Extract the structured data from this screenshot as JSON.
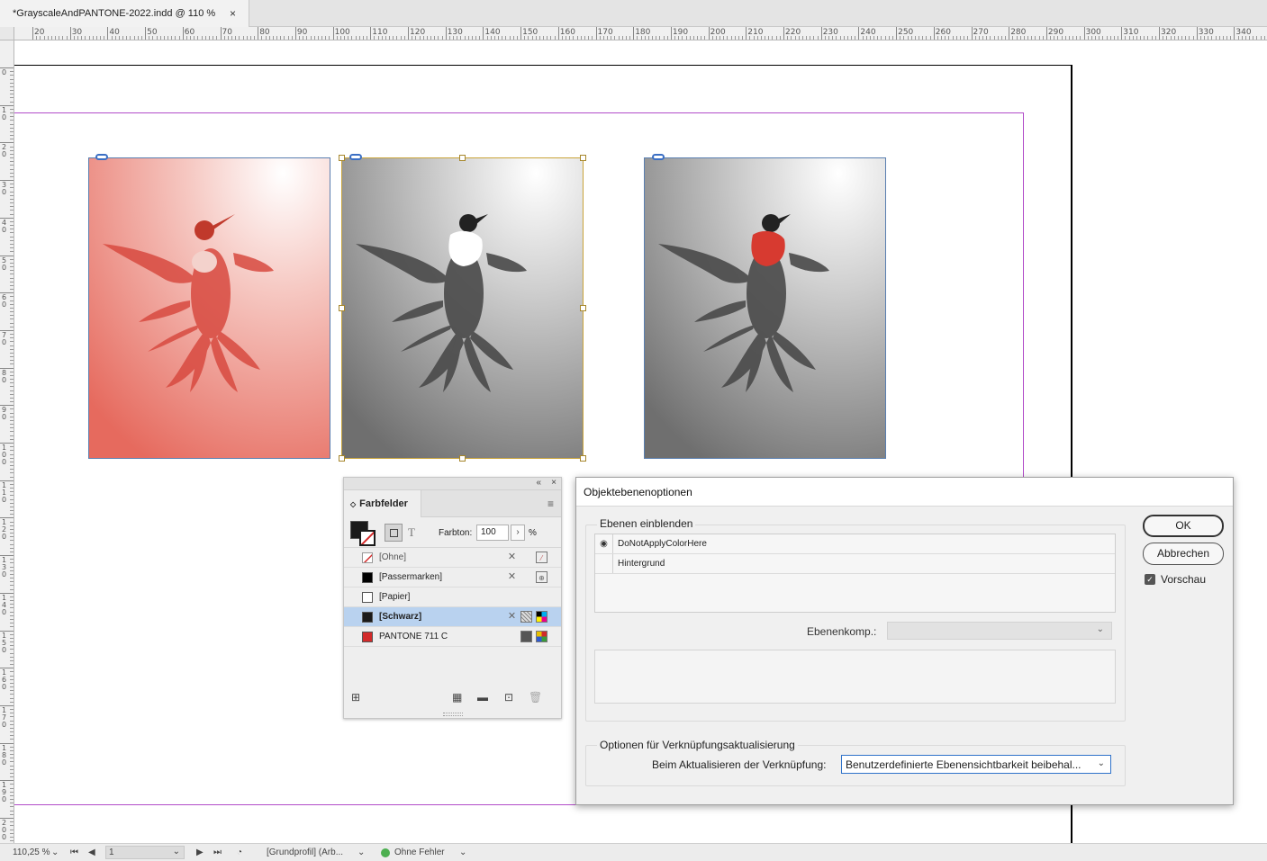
{
  "document_tab": {
    "title": "*GrayscaleAndPANTONE-2022.indd @ 110 %",
    "close_glyph": "×"
  },
  "ruler": {
    "top_labels": [
      "20",
      "30",
      "40",
      "50",
      "60",
      "70",
      "80",
      "90",
      "100",
      "110",
      "120",
      "130",
      "140",
      "150",
      "160",
      "170",
      "180",
      "190",
      "200",
      "210",
      "220",
      "230",
      "240",
      "250",
      "260",
      "270",
      "280",
      "290",
      "300",
      "310",
      "320",
      "330",
      "340"
    ],
    "left_labels": [
      "0",
      "10",
      "20",
      "30",
      "40",
      "50",
      "60",
      "70",
      "80",
      "90",
      "100",
      "110",
      "120",
      "130",
      "140",
      "150",
      "160",
      "170",
      "180",
      "190",
      "200"
    ]
  },
  "images": [
    {
      "name": "hummingbird-red-tint",
      "tint": "pantone-red"
    },
    {
      "name": "hummingbird-grayscale-selected",
      "tint": "grayscale-white-throat"
    },
    {
      "name": "hummingbird-grayscale-red-throat",
      "tint": "grayscale-red-throat"
    }
  ],
  "swatches_panel": {
    "title": "Farbfelder",
    "tint_label": "Farbton:",
    "tint_value": "100",
    "tint_unit": "%",
    "text_glyph": "T",
    "collapse_glyph": "«",
    "close_glyph": "×",
    "menu_glyph": "≡",
    "items": [
      {
        "name": "[Ohne]",
        "color": "none"
      },
      {
        "name": "[Passermarken]",
        "color": "#000000"
      },
      {
        "name": "[Papier]",
        "color": "#ffffff"
      },
      {
        "name": "[Schwarz]",
        "color": "#1a1a1a",
        "selected": true
      },
      {
        "name": "PANTONE 711 C",
        "color": "#d22a2a"
      }
    ]
  },
  "dialog": {
    "title": "Objektebenenoptionen",
    "show_layers_label": "Ebenen einblenden",
    "layers": [
      {
        "name": "DoNotApplyColorHere",
        "visible": true
      },
      {
        "name": "Hintergrund",
        "visible": false
      }
    ],
    "layer_comp_label": "Ebenenkomp.:",
    "layer_comp_value": "",
    "link_update_group_label": "Optionen für Verknüpfungsaktualisierung",
    "link_update_label": "Beim Aktualisieren der Verknüpfung:",
    "link_update_value": "Benutzerdefinierte Ebenensichtbarkeit beibehal...",
    "ok_label": "OK",
    "cancel_label": "Abbrechen",
    "preview_label": "Vorschau",
    "preview_checked": true
  },
  "statusbar": {
    "zoom": "110,25 %",
    "page": "1",
    "profile": "[Grundprofil] (Arb...",
    "preflight": "Ohne Fehler"
  },
  "colors": {
    "accent": "#2f72c9",
    "margin_guide": "#b24cc9",
    "selection": "#c9a43a",
    "pantone": "#d22a2a"
  }
}
